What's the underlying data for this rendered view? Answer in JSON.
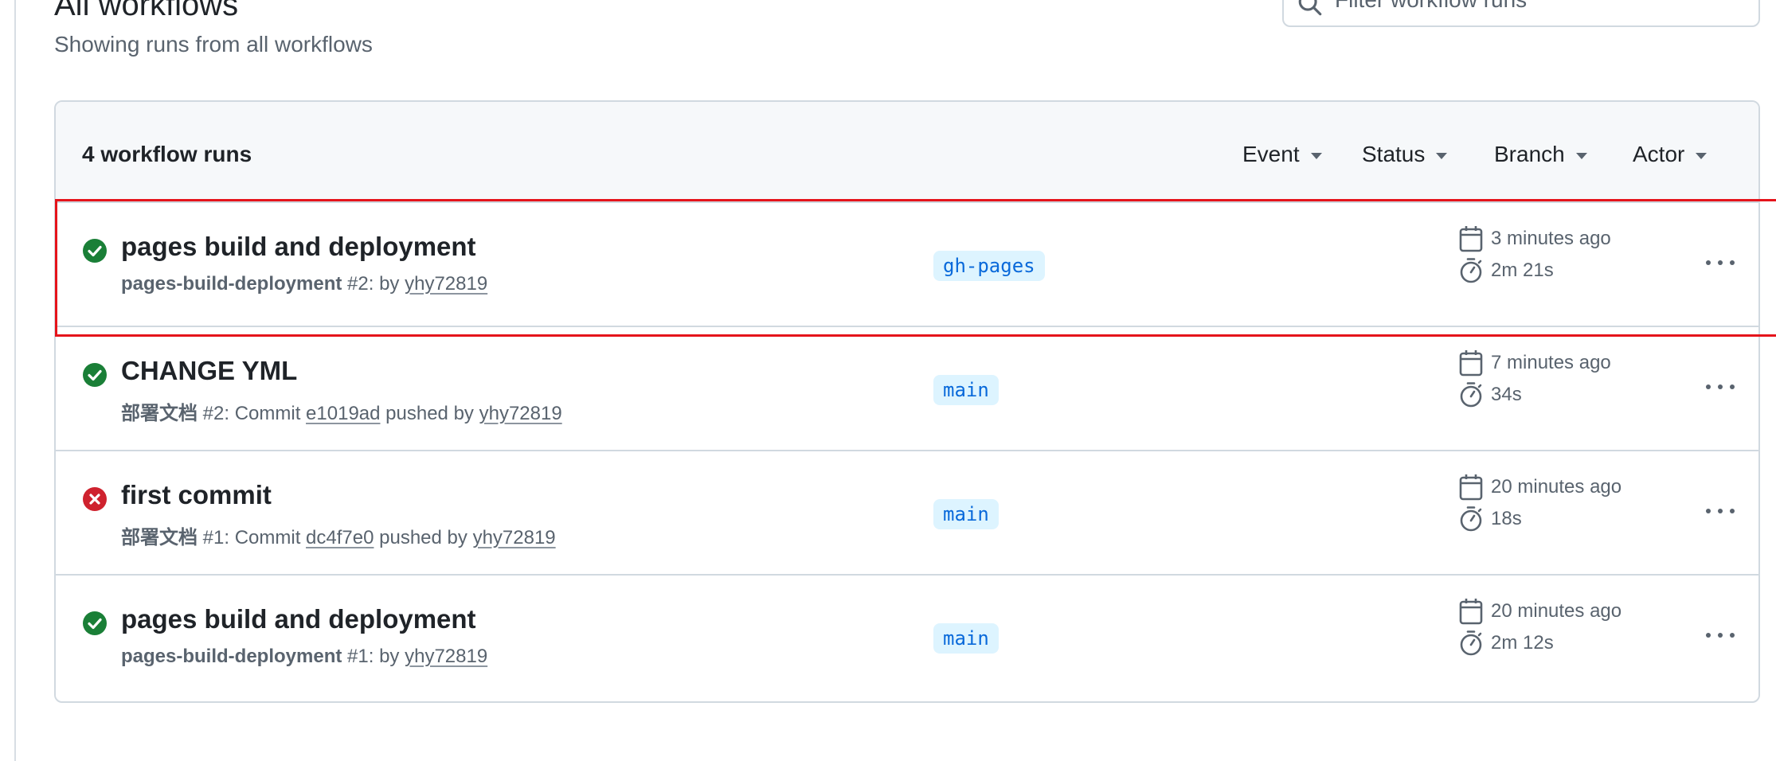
{
  "page": {
    "title": "All workflows",
    "subtitle": "Showing runs from all workflows"
  },
  "search": {
    "placeholder": "Filter workflow runs",
    "value": ""
  },
  "runs_header": {
    "count_label": "4 workflow runs",
    "filters": {
      "event": "Event",
      "status": "Status",
      "branch": "Branch",
      "actor": "Actor"
    }
  },
  "runs": [
    {
      "status": "success",
      "title": "pages build and deployment",
      "workflow": "pages-build-deployment",
      "number_text": "#2: by",
      "commit": "",
      "pushed_text": "",
      "actor": "yhy72819",
      "branch": "gh-pages",
      "time_ago": "3 minutes ago",
      "duration": "2m 21s"
    },
    {
      "status": "success",
      "title": "CHANGE YML",
      "workflow": "部署文档",
      "number_text": "#2: Commit",
      "commit": "e1019ad",
      "pushed_text": "pushed by",
      "actor": "yhy72819",
      "branch": "main",
      "time_ago": "7 minutes ago",
      "duration": "34s"
    },
    {
      "status": "failure",
      "title": "first commit",
      "workflow": "部署文档",
      "number_text": "#1: Commit",
      "commit": "dc4f7e0",
      "pushed_text": "pushed by",
      "actor": "yhy72819",
      "branch": "main",
      "time_ago": "20 minutes ago",
      "duration": "18s"
    },
    {
      "status": "success",
      "title": "pages build and deployment",
      "workflow": "pages-build-deployment",
      "number_text": "#1: by",
      "commit": "",
      "pushed_text": "",
      "actor": "yhy72819",
      "branch": "main",
      "time_ago": "20 minutes ago",
      "duration": "2m 12s"
    }
  ],
  "colors": {
    "success": "#1a7f37",
    "failure": "#cf222e",
    "branch_bg": "#ddf4ff",
    "branch_fg": "#0969da",
    "highlight": "#e5141b"
  },
  "icons": {
    "search": "search-icon",
    "success": "check-circle-icon",
    "failure": "x-circle-icon",
    "calendar": "calendar-icon",
    "duration": "stopwatch-icon",
    "more": "kebab-horizontal-icon"
  }
}
